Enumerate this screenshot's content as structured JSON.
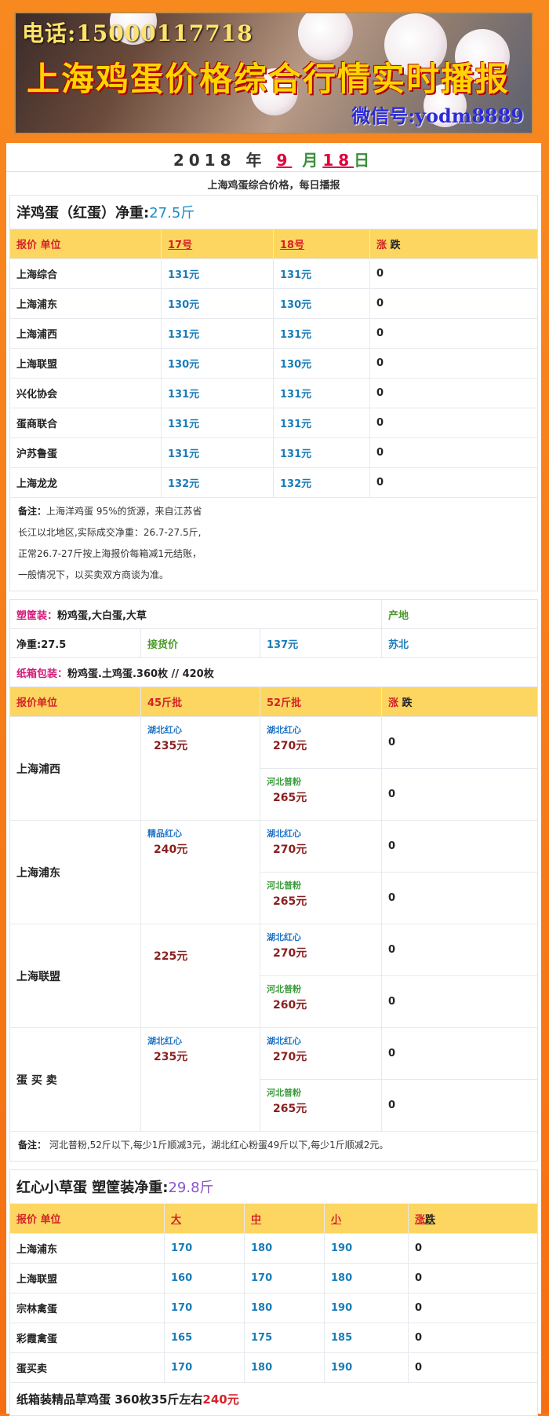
{
  "banner": {
    "phone": "电话:15000117718",
    "title": "上海鸡蛋价格综合行情实时播报",
    "wechat": "微信号:yodm8889"
  },
  "date": {
    "year": "2018",
    "year_unit": "年",
    "month": "9",
    "month_unit": "月",
    "day": "18",
    "day_unit": "日"
  },
  "subtitle": "上海鸡蛋综合价格，每日播报",
  "section1": {
    "title": "洋鸡蛋（红蛋）净重:",
    "weight": "27.5斤",
    "headers": [
      "报价 单位",
      "17号",
      "18号",
      "涨",
      "跌"
    ],
    "rows": [
      [
        "上海综合",
        "131元",
        "131元",
        "0"
      ],
      [
        "上海浦东",
        "130元",
        "130元",
        "0"
      ],
      [
        "上海浦西",
        "131元",
        "131元",
        "0"
      ],
      [
        "上海联盟",
        "130元",
        "130元",
        "0"
      ],
      [
        "兴化协会",
        "131元",
        "131元",
        "0"
      ],
      [
        "蛋商联合",
        "131元",
        "131元",
        "0"
      ],
      [
        "沪苏鲁蛋",
        "131元",
        "131元",
        "0"
      ],
      [
        "上海龙龙",
        "132元",
        "132元",
        "0"
      ]
    ],
    "note_label": "备注：",
    "note_lines": [
      "上海洋鸡蛋 95%的货源，来自江苏省",
      "长江以北地区,实际成交净重：26.7-27.5斤,",
      "正常26.7-27斤按上海报价每箱减1元结账，",
      "一般情况下，以买卖双方商谈为准。"
    ]
  },
  "section2": {
    "pack_label": "塑筐装：",
    "pack_value": "粉鸡蛋,大白蛋,大草",
    "origin_label": "产地",
    "weight_label": "净重:27.5",
    "receive_label": "接货价",
    "receive_price": "137元",
    "origin": "苏北",
    "carton_label": "纸箱包装：",
    "carton_value": "粉鸡蛋.土鸡蛋.360枚 // 420枚",
    "headers": [
      "报价单位",
      "45斤批",
      "52斤批",
      "涨",
      "跌"
    ],
    "groups": [
      {
        "name": "上海浦西",
        "a_sub": "湖北红心",
        "a_price": "235元",
        "b1_sub": "湖北红心",
        "b1_price": "270元",
        "c1": "0",
        "b2_sub": "河北普粉",
        "b2_price": "265元",
        "c2": "0"
      },
      {
        "name": "上海浦东",
        "a_sub": "精品红心",
        "a_price": "240元",
        "b1_sub": "湖北红心",
        "b1_price": "270元",
        "c1": "0",
        "b2_sub": "河北普粉",
        "b2_price": "265元",
        "c2": "0"
      },
      {
        "name": "上海联盟",
        "a_sub": "",
        "a_price": "225元",
        "b1_sub": "湖北红心",
        "b1_price": "270元",
        "c1": "0",
        "b2_sub": "河北普粉",
        "b2_price": "260元",
        "c2": "0"
      },
      {
        "name": "蛋 买 卖",
        "a_sub": "湖北红心",
        "a_price": "235元",
        "b1_sub": "湖北红心",
        "b1_price": "270元",
        "c1": "0",
        "b2_sub": "河北普粉",
        "b2_price": "265元",
        "c2": "0"
      }
    ],
    "note_label": "备注：",
    "note": "河北普粉,52斤以下,每少1斤顺减3元，湖北红心粉蛋49斤以下,每少1斤顺减2元。"
  },
  "section3": {
    "title": "红心小草蛋 塑筐装净重:",
    "weight": "29.8斤",
    "headers": [
      "报价 单位",
      "大",
      "中",
      "小",
      "涨",
      "跌"
    ],
    "rows": [
      [
        "上海浦东",
        "170",
        "180",
        "190",
        "0"
      ],
      [
        "上海联盟",
        "160",
        "170",
        "180",
        "0"
      ],
      [
        "宗林禽蛋",
        "170",
        "180",
        "190",
        "0"
      ],
      [
        "彩霞禽蛋",
        "165",
        "175",
        "185",
        "0"
      ],
      [
        "蛋买卖",
        "170",
        "180",
        "190",
        "0"
      ]
    ],
    "bottom_text": "纸箱装精品草鸡蛋 360枚35斤左右",
    "bottom_price": "240元"
  }
}
